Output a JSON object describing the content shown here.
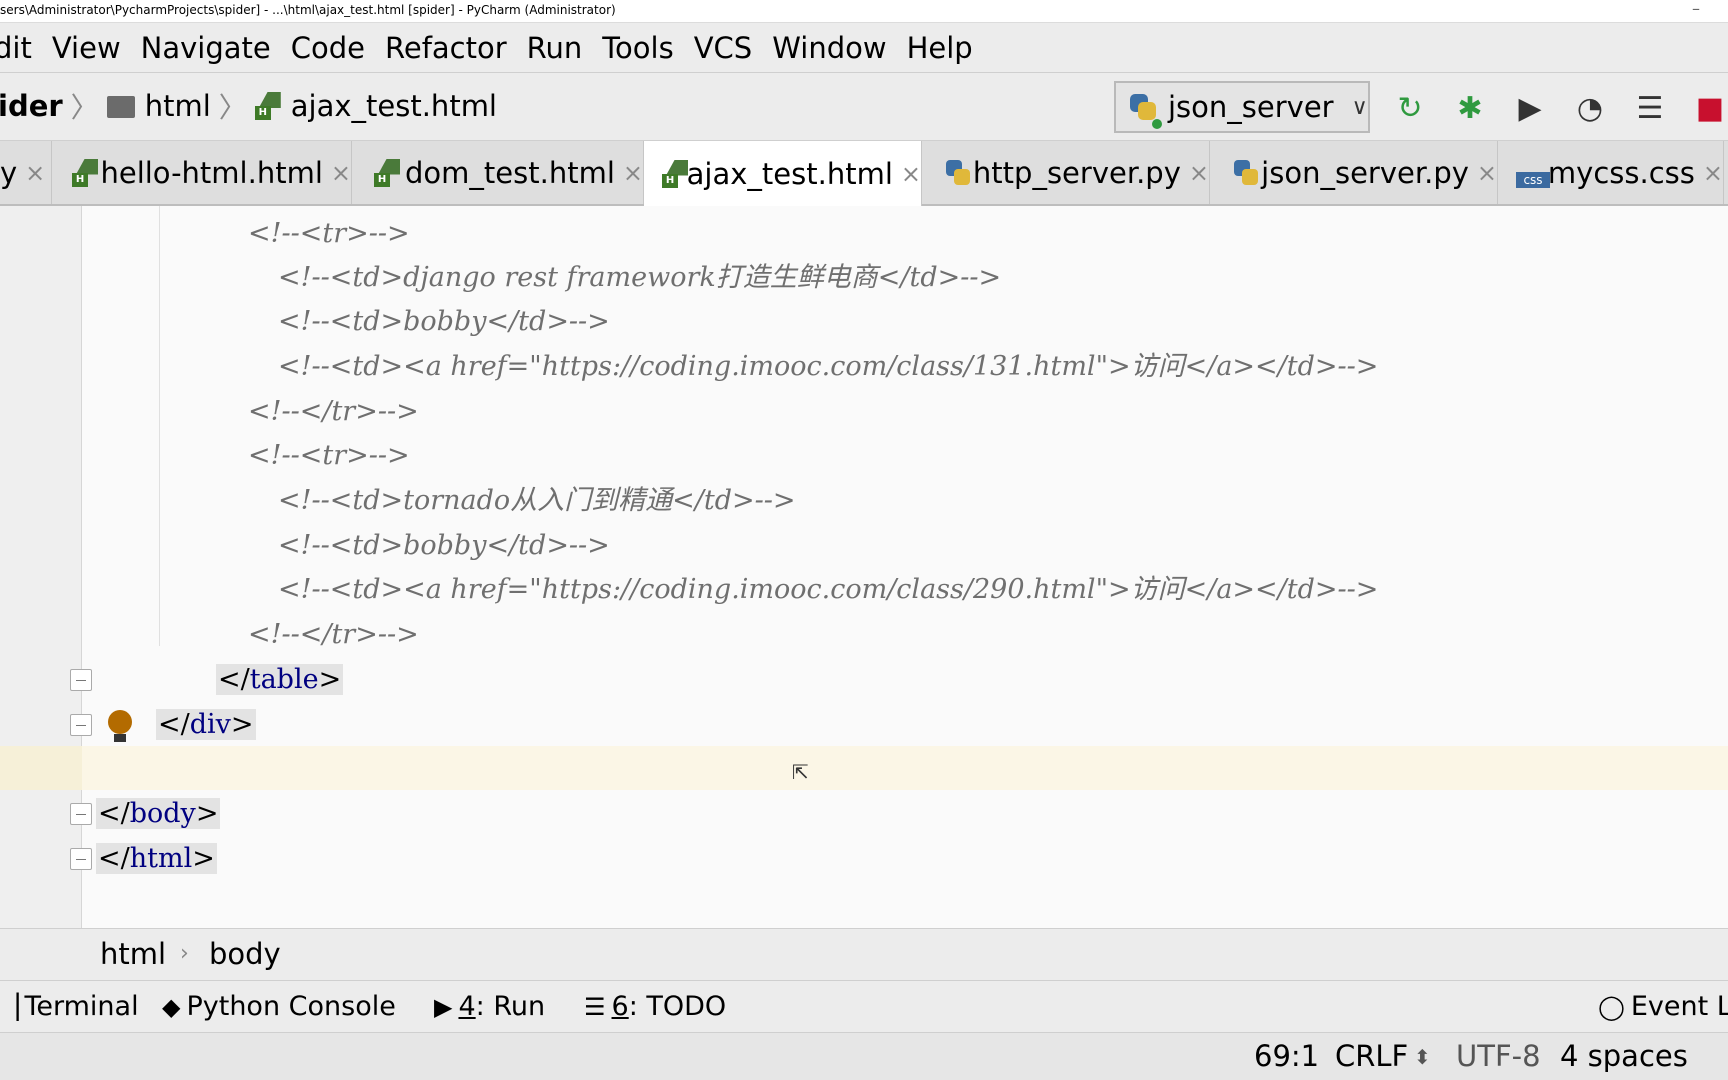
{
  "window": {
    "title": "sers\\Administrator\\PycharmProjects\\spider] - ...\\html\\ajax_test.html [spider] - PyCharm (Administrator)"
  },
  "menu": [
    "dit",
    "View",
    "Navigate",
    "Code",
    "Refactor",
    "Run",
    "Tools",
    "VCS",
    "Window",
    "Help"
  ],
  "nav": {
    "project": "ider",
    "folder": "html",
    "file": "ajax_test.html",
    "run_config": "json_server"
  },
  "toolbar_icons": [
    "rerun-icon",
    "debug-icon",
    "coverage-icon",
    "profile-icon",
    "run-concurrency-icon",
    "stop-icon"
  ],
  "tabs": [
    {
      "label": "y",
      "icon": "none",
      "active": false
    },
    {
      "label": "hello-html.html",
      "icon": "html-file-icon",
      "active": false
    },
    {
      "label": "dom_test.html",
      "icon": "html-file-icon",
      "active": false
    },
    {
      "label": "ajax_test.html",
      "icon": "html-file-icon",
      "active": true
    },
    {
      "label": "http_server.py",
      "icon": "python-file-icon",
      "active": false
    },
    {
      "label": "json_server.py",
      "icon": "python-file-icon",
      "active": false
    },
    {
      "label": "mycss.css",
      "icon": "css-file-icon",
      "active": false
    }
  ],
  "editor": {
    "lines": [
      "<!--<tr>-->",
      "<!--<td>django rest framework打造生鲜电商</td>-->",
      "<!--<td>bobby</td>-->",
      "<!--<td><a href=\"https://coding.imooc.com/class/131.html\">访问</a></td>-->",
      "<!--</tr>-->",
      "<!--<tr>-->",
      "<!--<td>tornado从入门到精通</td>-->",
      "<!--<td>bobby</td>-->",
      "<!--<td><a href=\"https://coding.imooc.com/class/290.html\">访问</a></td>-->",
      "<!--</tr>-->"
    ],
    "tags": {
      "table_close": "table",
      "div_close": "div",
      "body_close": "body",
      "html_close": "html"
    }
  },
  "breadcrumb": [
    "html",
    "body"
  ],
  "tool_windows": {
    "terminal": "Terminal",
    "python_console": "Python Console",
    "run_num": "4",
    "run": ": Run",
    "todo_num": "6",
    "todo": ": TODO",
    "event_log": "Event Lo"
  },
  "status": {
    "position": "69:1",
    "line_sep": "CRLF",
    "encoding": "UTF-8",
    "indent": "4 spaces"
  },
  "colors": {
    "active_tab": "#ffffff",
    "tag_name": "#000080",
    "comment": "#6f6f6f",
    "current_line": "#fbf6e6",
    "stop": "#c8102e",
    "run_green": "#2f9a3f"
  }
}
